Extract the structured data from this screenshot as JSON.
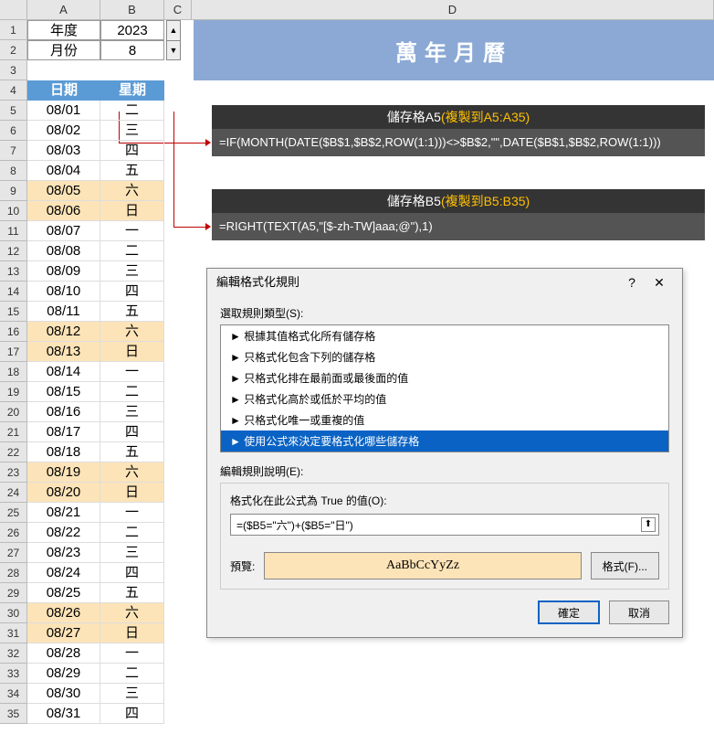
{
  "columns": [
    "A",
    "B",
    "C",
    "D"
  ],
  "header": {
    "year_label": "年度",
    "year_value": "2023",
    "month_label": "月份",
    "month_value": "8"
  },
  "banner": "萬年月曆",
  "table_headers": {
    "date": "日期",
    "weekday": "星期"
  },
  "rows": [
    {
      "r": 5,
      "date": "08/01",
      "wd": "二",
      "we": false
    },
    {
      "r": 6,
      "date": "08/02",
      "wd": "三",
      "we": false
    },
    {
      "r": 7,
      "date": "08/03",
      "wd": "四",
      "we": false
    },
    {
      "r": 8,
      "date": "08/04",
      "wd": "五",
      "we": false
    },
    {
      "r": 9,
      "date": "08/05",
      "wd": "六",
      "we": true
    },
    {
      "r": 10,
      "date": "08/06",
      "wd": "日",
      "we": true
    },
    {
      "r": 11,
      "date": "08/07",
      "wd": "一",
      "we": false
    },
    {
      "r": 12,
      "date": "08/08",
      "wd": "二",
      "we": false
    },
    {
      "r": 13,
      "date": "08/09",
      "wd": "三",
      "we": false
    },
    {
      "r": 14,
      "date": "08/10",
      "wd": "四",
      "we": false
    },
    {
      "r": 15,
      "date": "08/11",
      "wd": "五",
      "we": false
    },
    {
      "r": 16,
      "date": "08/12",
      "wd": "六",
      "we": true
    },
    {
      "r": 17,
      "date": "08/13",
      "wd": "日",
      "we": true
    },
    {
      "r": 18,
      "date": "08/14",
      "wd": "一",
      "we": false
    },
    {
      "r": 19,
      "date": "08/15",
      "wd": "二",
      "we": false
    },
    {
      "r": 20,
      "date": "08/16",
      "wd": "三",
      "we": false
    },
    {
      "r": 21,
      "date": "08/17",
      "wd": "四",
      "we": false
    },
    {
      "r": 22,
      "date": "08/18",
      "wd": "五",
      "we": false
    },
    {
      "r": 23,
      "date": "08/19",
      "wd": "六",
      "we": true
    },
    {
      "r": 24,
      "date": "08/20",
      "wd": "日",
      "we": true
    },
    {
      "r": 25,
      "date": "08/21",
      "wd": "一",
      "we": false
    },
    {
      "r": 26,
      "date": "08/22",
      "wd": "二",
      "we": false
    },
    {
      "r": 27,
      "date": "08/23",
      "wd": "三",
      "we": false
    },
    {
      "r": 28,
      "date": "08/24",
      "wd": "四",
      "we": false
    },
    {
      "r": 29,
      "date": "08/25",
      "wd": "五",
      "we": false
    },
    {
      "r": 30,
      "date": "08/26",
      "wd": "六",
      "we": true
    },
    {
      "r": 31,
      "date": "08/27",
      "wd": "日",
      "we": true
    },
    {
      "r": 32,
      "date": "08/28",
      "wd": "一",
      "we": false
    },
    {
      "r": 33,
      "date": "08/29",
      "wd": "二",
      "we": false
    },
    {
      "r": 34,
      "date": "08/30",
      "wd": "三",
      "we": false
    },
    {
      "r": 35,
      "date": "08/31",
      "wd": "四",
      "we": false
    }
  ],
  "formula_a": {
    "title": "儲存格A5",
    "copy": "(複製到A5:A35)",
    "body": "=IF(MONTH(DATE($B$1,$B$2,ROW(1:1)))<>$B$2,\"\",DATE($B$1,$B$2,ROW(1:1)))"
  },
  "formula_b": {
    "title": "儲存格B5",
    "copy": "(複製到B5:B35)",
    "body": "=RIGHT(TEXT(A5,\"[$-zh-TW]aaa;@\"),1)"
  },
  "dialog": {
    "title": "編輯格式化規則",
    "select_label": "選取規則類型(S):",
    "rules": [
      "► 根據其值格式化所有儲存格",
      "► 只格式化包含下列的儲存格",
      "► 只格式化排在最前面或最後面的值",
      "► 只格式化高於或低於平均的值",
      "► 只格式化唯一或重複的值",
      "► 使用公式來決定要格式化哪些儲存格"
    ],
    "selected_rule": 5,
    "edit_label": "編輯規則說明(E):",
    "formula_label": "格式化在此公式為 True 的值(O):",
    "formula_value": "=($B5=\"六\")+($B5=\"日\")",
    "preview_label": "預覽:",
    "preview_text": "AaBbCcYyZz",
    "format_btn": "格式(F)...",
    "ok": "確定",
    "cancel": "取消"
  }
}
